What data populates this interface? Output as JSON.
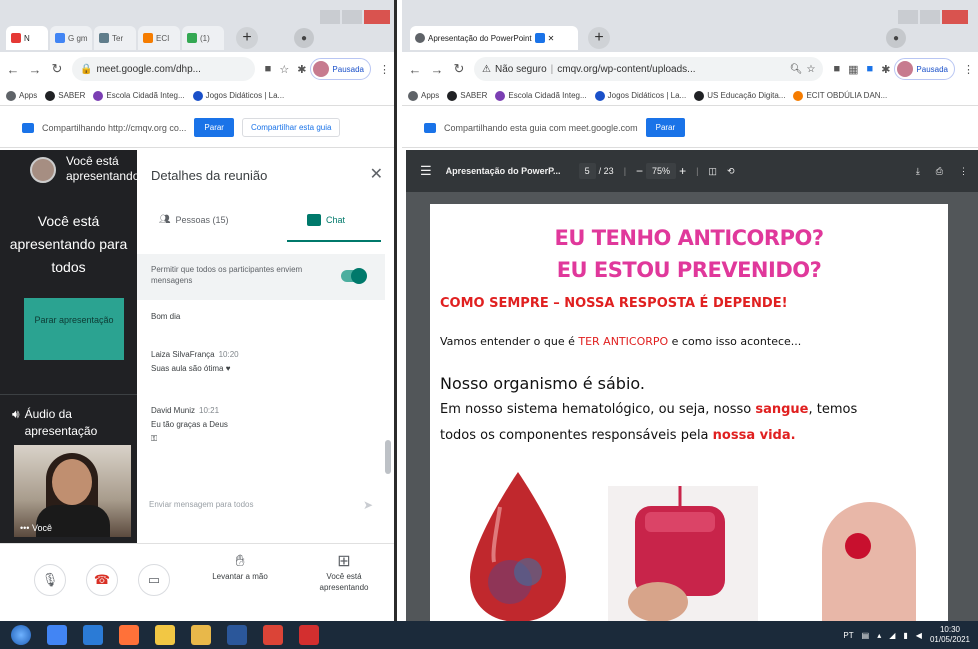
{
  "left_browser": {
    "tabs": [
      {
        "label": "N",
        "color": "#e53935"
      },
      {
        "label": "G gm",
        "color": "#4285f4"
      },
      {
        "label": "Ter",
        "color": "#607d8b"
      },
      {
        "label": "ECI",
        "color": "#f57c00"
      },
      {
        "label": "(1)",
        "color": "#34a853"
      }
    ],
    "url": "meet.google.com/dhp...",
    "profile_label": "Pausada",
    "bookmarks": [
      {
        "label": "Apps",
        "color": "#5f6368"
      },
      {
        "label": "SABER",
        "color": "#202124"
      },
      {
        "label": "Escola Cidadã Integ...",
        "color": "#7b3fb3"
      },
      {
        "label": "Jogos Didáticos | La...",
        "color": "#1a50c9"
      }
    ],
    "infobar_text": "Compartilhando http://cmqv.org co...",
    "infobar_stop": "Parar",
    "infobar_share": "Compartilhar esta guia"
  },
  "meet": {
    "presenting_title": "Você está apresentando",
    "presenting_big": "Você está apresentando para todos",
    "stop_presenting": "Parar apresentação",
    "audio_label": "Áudio da apresentação",
    "self_label": "Você",
    "panel_title": "Detalhes da reunião",
    "people_tab": "Pessoas (15)",
    "chat_tab": "Chat",
    "permission_text": "Permitir que todos os participantes enviem mensagens",
    "messages": [
      {
        "name": "",
        "time": "",
        "text": "Bom dia"
      },
      {
        "name": "Laiza SilvaFrança",
        "time": "10:20",
        "text": "Suas aula são ótima ♥"
      },
      {
        "name": "David Muniz",
        "time": "10:21",
        "text": "Eu tão graças a Deus"
      }
    ],
    "send_placeholder": "Enviar mensagem para todos",
    "raise_hand": "Levantar a mão",
    "you_presenting": "Você está apresentando"
  },
  "right_browser": {
    "tab_label": "Apresentação do PowerPoint",
    "security_label": "Não seguro",
    "url": "cmqv.org/wp-content/uploads...",
    "profile_label": "Pausada",
    "bookmarks": [
      {
        "label": "Apps",
        "color": "#5f6368"
      },
      {
        "label": "SABER",
        "color": "#202124"
      },
      {
        "label": "Escola Cidadã Integ...",
        "color": "#7b3fb3"
      },
      {
        "label": "Jogos Didáticos | La...",
        "color": "#1a50c9"
      },
      {
        "label": "US Educação Digita...",
        "color": "#202124"
      },
      {
        "label": "ECIT OBDÚLIA DAN...",
        "color": "#f57c00"
      }
    ],
    "infobar_text": "Compartilhando esta guia com meet.google.com",
    "infobar_stop": "Parar"
  },
  "pdf": {
    "title": "Apresentação do PowerP...",
    "page_current": "5",
    "page_total": "/ 23",
    "zoom": "75%"
  },
  "slide": {
    "title_line1": "EU TENHO ANTICORPO?",
    "title_line2": "EU ESTOU PREVENIDO?",
    "subtitle": "COMO SEMPRE – NOSSA RESPOSTA É DEPENDE!",
    "intro_before": "Vamos entender o que é ",
    "intro_highlight": "TER ANTICORPO",
    "intro_after": " e como isso acontece...",
    "heading": "Nosso organismo é sábio.",
    "body_l1_before": "Em nosso sistema hematológico, ou seja, nosso ",
    "body_l1_highlight": "sangue",
    "body_l1_after": ",  temos",
    "body_l2_before": "todos  os componentes responsáveis pela ",
    "body_l2_highlight": "nossa vida."
  },
  "taskbar": {
    "language": "PT",
    "time": "10:30",
    "date": "01/05/2021",
    "apps": [
      {
        "name": "chrome",
        "color": "#4285f4"
      },
      {
        "name": "edge",
        "color": "#2b7bd6"
      },
      {
        "name": "firefox",
        "color": "#ff7139"
      },
      {
        "name": "media",
        "color": "#f2c744"
      },
      {
        "name": "folder",
        "color": "#e8b84a"
      },
      {
        "name": "word",
        "color": "#2b579a"
      },
      {
        "name": "chrome-active",
        "color": "#db4437"
      },
      {
        "name": "acrobat",
        "color": "#d32f2f"
      }
    ]
  }
}
